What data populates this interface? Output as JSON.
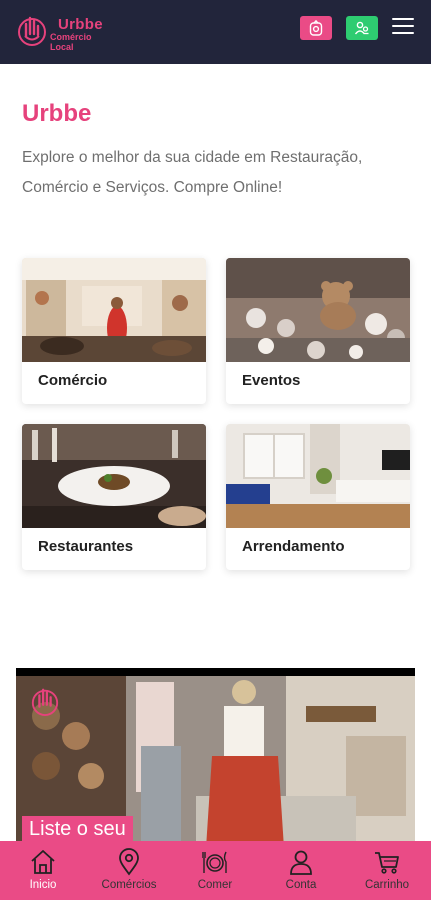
{
  "header": {
    "logo_title": "Urbbe",
    "logo_subtitle": "Comércio Local",
    "pink_button_icon": "user-badge-icon",
    "green_button_icon": "users-icon",
    "menu_icon": "hamburger-menu-icon"
  },
  "intro": {
    "title": "Urbbe",
    "description": "Explore o melhor da sua cidade em Restauração, Comércio e Serviços. Compre Online!"
  },
  "categories": [
    {
      "label": "Comércio",
      "image": "shop-photo"
    },
    {
      "label": "Eventos",
      "image": "teddy-bears-photo"
    },
    {
      "label": "Restaurantes",
      "image": "restaurant-photo"
    },
    {
      "label": "Arrendamento",
      "image": "living-room-photo"
    }
  ],
  "banner": {
    "text": "Liste o seu"
  },
  "bottom_nav": {
    "items": [
      {
        "label": "Inicio",
        "icon": "home-icon",
        "active": true
      },
      {
        "label": "Comércios",
        "icon": "map-pin-icon",
        "active": false
      },
      {
        "label": "Comer",
        "icon": "dish-icon",
        "active": false
      },
      {
        "label": "Conta",
        "icon": "user-icon",
        "active": false
      },
      {
        "label": "Carrinho",
        "icon": "cart-icon",
        "active": false
      }
    ]
  },
  "colors": {
    "header_bg": "#22253b",
    "brand_pink": "#e6427c",
    "nav_bg": "#ea4b86",
    "green": "#2ecc71"
  }
}
